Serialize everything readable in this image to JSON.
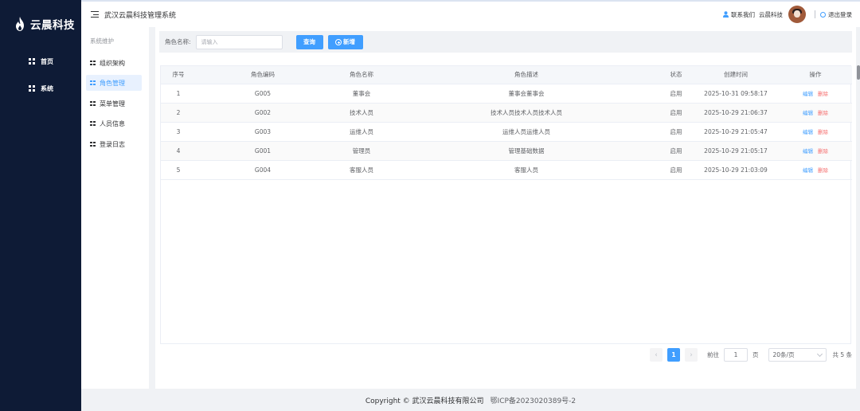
{
  "brand": {
    "name": "云晨科技"
  },
  "sidebar": {
    "items": [
      {
        "label": "首页"
      },
      {
        "label": "系统"
      }
    ]
  },
  "header": {
    "title": "武汉云晨科技管理系统",
    "contact_label": "联系我们",
    "company_label": "云晨科技",
    "logout_label": "退出登录"
  },
  "submenu": {
    "title": "系统维护",
    "items": [
      {
        "label": "组织架构",
        "active": false
      },
      {
        "label": "角色管理",
        "active": true
      },
      {
        "label": "菜单管理",
        "active": false
      },
      {
        "label": "人员信息",
        "active": false
      },
      {
        "label": "登录日志",
        "active": false
      }
    ]
  },
  "filter": {
    "label": "角色名称:",
    "placeholder": "请输入",
    "query_button": "查询",
    "add_button": "新增"
  },
  "table": {
    "headers": [
      "序号",
      "角色编码",
      "角色名称",
      "角色描述",
      "状态",
      "创建时间",
      "操作"
    ],
    "rows": [
      [
        "1",
        "G005",
        "董事会",
        "董事会董事会",
        "启用",
        "2025-10-31 09:58:17"
      ],
      [
        "2",
        "G002",
        "技术人员",
        "技术人员技术人员技术人员",
        "启用",
        "2025-10-29 21:06:37"
      ],
      [
        "3",
        "G003",
        "运维人员",
        "运维人员运维人员",
        "启用",
        "2025-10-29 21:05:47"
      ],
      [
        "4",
        "G001",
        "管理员",
        "管理基础数据",
        "启用",
        "2025-10-29 21:05:17"
      ],
      [
        "5",
        "G004",
        "客服人员",
        "客服人员",
        "启用",
        "2025-10-29 21:03:09"
      ]
    ],
    "edit_label": "编辑",
    "delete_label": "删除"
  },
  "pagination": {
    "prev": "‹",
    "next": "›",
    "current_page": "1",
    "goto_label": "前往",
    "goto_value": "1",
    "page_suffix": "页",
    "page_size": "20条/页",
    "total": "共 5 条"
  },
  "footer": {
    "copyright": "Copyright © 武汉云晨科技有限公司",
    "icp": "鄂ICP备2023020389号-2"
  },
  "colors": {
    "sidebar_bg": "#0e1b36",
    "accent": "#409eff",
    "danger": "#f56c6c"
  }
}
